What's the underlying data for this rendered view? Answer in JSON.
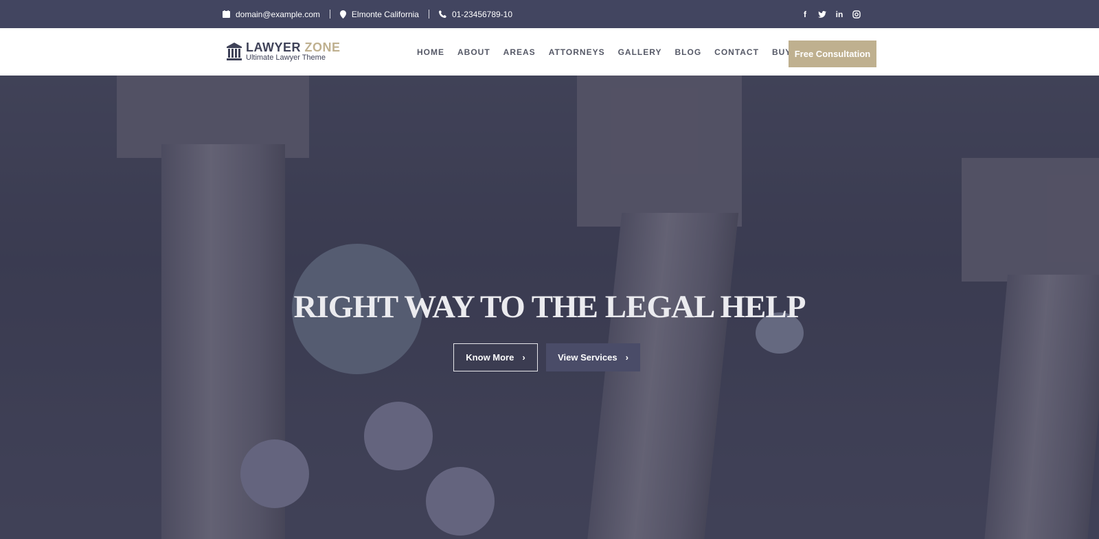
{
  "topbar": {
    "email": "domain@example.com",
    "location": "Elmonte California",
    "phone": "01-23456789-10",
    "social": [
      "facebook",
      "twitter",
      "linkedin",
      "instagram"
    ]
  },
  "logo": {
    "title_a": "LAWYER",
    "title_b": "ZONE",
    "tagline": "Ultimate Lawyer Theme"
  },
  "menu": [
    "HOME",
    "ABOUT",
    "AREAS",
    "ATTORNEYS",
    "GALLERY",
    "BLOG",
    "CONTACT",
    "BUY PRO"
  ],
  "cta": "Free Consultation",
  "hero": {
    "title": "RIGHT WAY TO THE LEGAL HELP",
    "know_more": "Know More",
    "view_services": "View Services"
  },
  "colors": {
    "topbar": "#424560",
    "accent": "#bfb08f",
    "dark": "#3f4258"
  }
}
